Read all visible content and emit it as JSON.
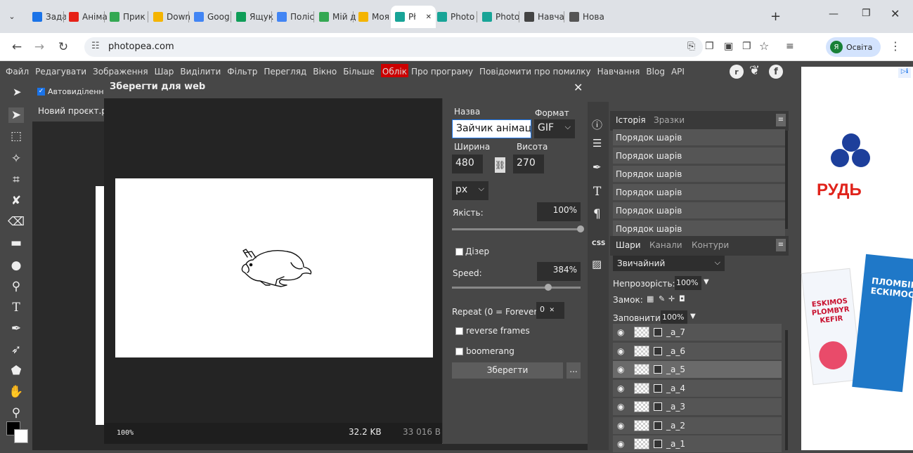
{
  "browser": {
    "tabs": [
      {
        "label": "Задан",
        "color": "#1a73e8",
        "icon": "classroom-icon"
      },
      {
        "label": "Аніма",
        "color": "#e62117",
        "icon": "youtube-icon"
      },
      {
        "label": "Прик",
        "color": "#34a853",
        "icon": "drive-icon"
      },
      {
        "label": "Down",
        "color": "#f4b400",
        "icon": "windows-icon"
      },
      {
        "label": "Goog",
        "color": "#4285f4",
        "icon": "chrome-icon"
      },
      {
        "label": "Ящук",
        "color": "#0f9d58",
        "icon": "sheets-icon"
      },
      {
        "label": "Поліс",
        "color": "#4285f4",
        "icon": "calendar-icon"
      },
      {
        "label": "Мій д",
        "color": "#34a853",
        "icon": "drive-icon"
      },
      {
        "label": "Моя р",
        "color": "#f4b400",
        "icon": "slides-icon"
      },
      {
        "label": "Pł",
        "color": "#18a497",
        "icon": "photopea-icon",
        "active": true
      },
      {
        "label": "Photo",
        "color": "#18a497",
        "icon": "photopea-icon"
      },
      {
        "label": "Photo",
        "color": "#18a497",
        "icon": "photopea-icon"
      },
      {
        "label": "Навча",
        "color": "#444",
        "icon": "openai-icon"
      },
      {
        "label": "Нова",
        "color": "#555",
        "icon": "newtab-icon"
      }
    ],
    "url": "photopea.com",
    "profile_label": "Освіта",
    "profile_initial": "Я"
  },
  "menu": [
    "Файл",
    "Редагувати",
    "Зображення",
    "Шар",
    "Виділити",
    "Фільтр",
    "Перегляд",
    "Вікно",
    "Більше",
    "Облік",
    "Про програму",
    "Повідомити про помилку",
    "Навчання",
    "Blog",
    "API"
  ],
  "options": {
    "autoselect_label": "Автовиділення"
  },
  "document_tab": "Новий проєкт.p",
  "dialog": {
    "title": "Зберегти для web",
    "name_label": "Назва",
    "name_value": "Зайчик анімац",
    "format_label": "Формат",
    "format_value": "GIF",
    "width_label": "Ширина",
    "height_label": "Висота",
    "width_value": "480",
    "height_value": "270",
    "unit_value": "px",
    "quality_label": "Якість:",
    "quality_value": "100%",
    "quality": 1.0,
    "dither_label": "Дізер",
    "speed_label": "Speed:",
    "speed_value": "384%",
    "speed": 0.75,
    "repeat_label": "Repeat (0 = Forever):",
    "repeat_value": "0",
    "reverse_label": "reverse frames",
    "boomerang_label": "boomerang",
    "save_label": "Зберегти",
    "more_label": "...",
    "zoom": "100%",
    "size_kb": "32.2 KB",
    "size_bytes": "33 016 B"
  },
  "history": {
    "tabs": [
      "Історія",
      "Зразки"
    ],
    "items": [
      "Порядок шарів",
      "Порядок шарів",
      "Порядок шарів",
      "Порядок шарів",
      "Порядок шарів",
      "Порядок шарів"
    ]
  },
  "layers": {
    "tabs": [
      "Шари",
      "Канали",
      "Контури"
    ],
    "blend_mode": "Звичайний",
    "opacity_label": "Непрозорість:",
    "opacity_value": "100%",
    "lock_label": "Замок:",
    "fill_label": "Заповнити:",
    "fill_value": "100%",
    "items": [
      "_a_7",
      "_a_6",
      "_a_5",
      "_a_4",
      "_a_3",
      "_a_2",
      "_a_1"
    ],
    "selected_index": 2
  },
  "ad": {
    "brand": "РУДЬ",
    "product_1": "ESKIMOS PLOMBYR KEFIR",
    "product_2": "ПЛОМБІР ЕСКІМОС"
  }
}
